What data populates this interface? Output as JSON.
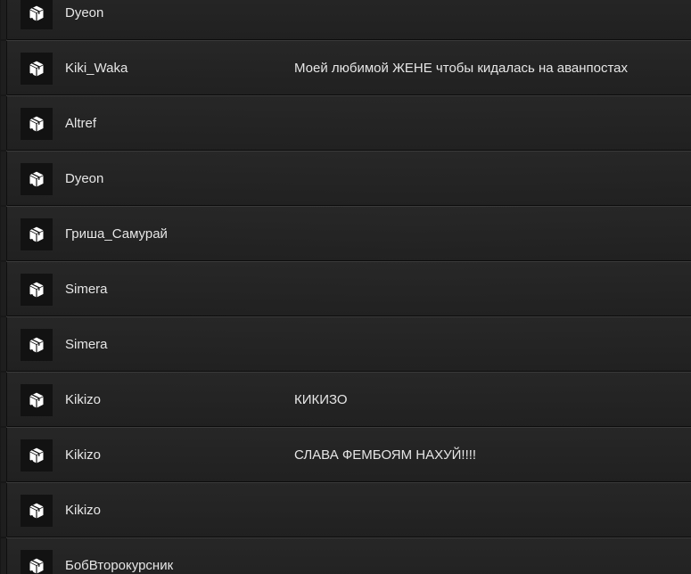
{
  "donations": {
    "rows": [
      {
        "name": "Dyeon",
        "message": "",
        "icon": "package-icon"
      },
      {
        "name": "Kiki_Waka",
        "message": "Моей любимой ЖЕНЕ чтобы кидалась на аванпостах",
        "icon": "package-icon"
      },
      {
        "name": "Altref",
        "message": "",
        "icon": "package-icon"
      },
      {
        "name": "Dyeon",
        "message": "",
        "icon": "package-icon"
      },
      {
        "name": "Гриша_Самурай",
        "message": "",
        "icon": "package-icon"
      },
      {
        "name": "Simera",
        "message": "",
        "icon": "package-icon"
      },
      {
        "name": "Simera",
        "message": "",
        "icon": "package-icon"
      },
      {
        "name": "Kikizo",
        "message": "КИКИЗО",
        "icon": "package-icon"
      },
      {
        "name": "Kikizo",
        "message": "СЛАВА ФЕМБОЯМ НАХУЙ!!!!",
        "icon": "package-icon"
      },
      {
        "name": "Kikizo",
        "message": "",
        "icon": "package-icon"
      },
      {
        "name": "БобВторокурсник",
        "message": "",
        "icon": "package-icon"
      }
    ]
  },
  "colors": {
    "background": "#1b1b1b",
    "row": "#262626",
    "icon_box": "#121212",
    "text": "#e6e6e6"
  }
}
